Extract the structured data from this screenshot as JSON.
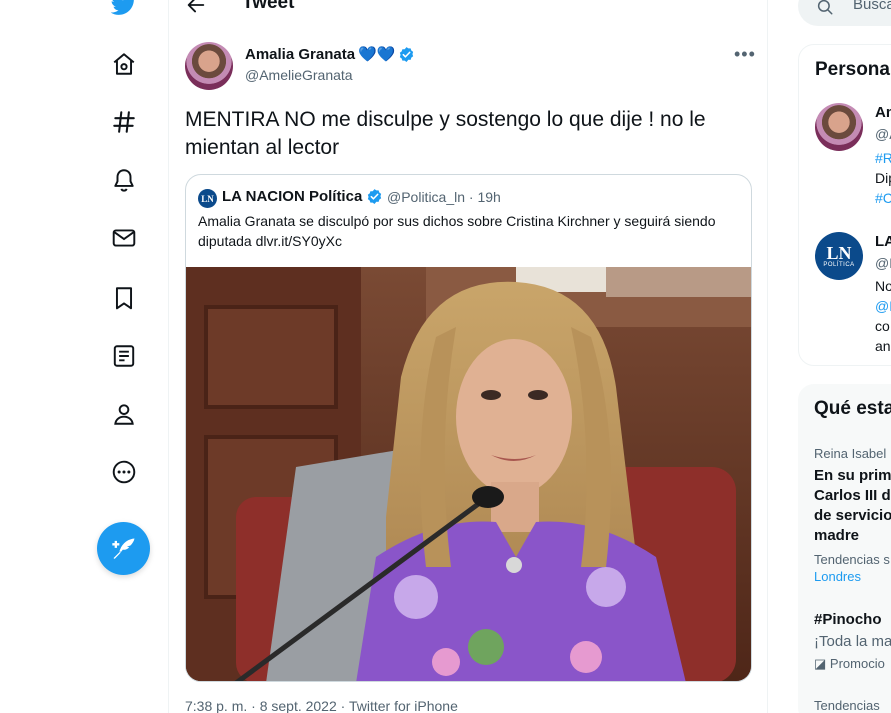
{
  "nav": {
    "items": [
      {
        "name": "twitter-logo-icon"
      },
      {
        "name": "home-icon"
      },
      {
        "name": "explore-icon"
      },
      {
        "name": "notifications-icon"
      },
      {
        "name": "messages-icon"
      },
      {
        "name": "bookmarks-icon"
      },
      {
        "name": "lists-icon"
      },
      {
        "name": "profile-icon"
      },
      {
        "name": "more-icon"
      }
    ]
  },
  "header": {
    "title": "Tweet"
  },
  "tweet": {
    "author_name": "Amalia Granata",
    "author_hearts": "💙💙",
    "author_handle": "@AmelieGranata",
    "text": "MENTIRA NO me disculpe y sostengo lo que dije ! no le mientan al lector",
    "timestamp": "7:38 p. m. · 8 sept. 2022 · Twitter for iPhone"
  },
  "quote": {
    "avatar_text": "LN",
    "name": "LA NACION Política",
    "meta": "@Politica_ln · 19h",
    "text": "Amalia Granata se disculpó por sus dichos sobre Cristina Kirchner y seguirá siendo diputada dlvr.it/SY0yXc"
  },
  "search": {
    "placeholder": "Busca"
  },
  "relevant": {
    "title": "Persona",
    "people": [
      {
        "name": "Am",
        "handle": "@A",
        "lines": [
          "#R",
          "Dip",
          "#C"
        ]
      },
      {
        "avatar_top": "LN",
        "avatar_bottom": "POLÍTICA",
        "name": "LA",
        "handle": "@P",
        "lines": [
          "No",
          "@L",
          "co",
          "an"
        ]
      }
    ]
  },
  "trends": {
    "title": "Qué esta",
    "items": [
      {
        "context": "Reina Isabel I",
        "lines": [
          "En su primo",
          "Carlos III d",
          "de servicio",
          "madre"
        ],
        "footer": "Tendencias s",
        "link": "Londres"
      },
      {
        "hashtag": "#Pinocho",
        "text": "¡Toda la ma",
        "promo": "Promocio"
      },
      {
        "context": "Tendencias"
      }
    ]
  },
  "colors": {
    "accent": "#1d9bf0",
    "text": "#0f1419",
    "secondary": "#536471",
    "border": "#cfd9de"
  }
}
